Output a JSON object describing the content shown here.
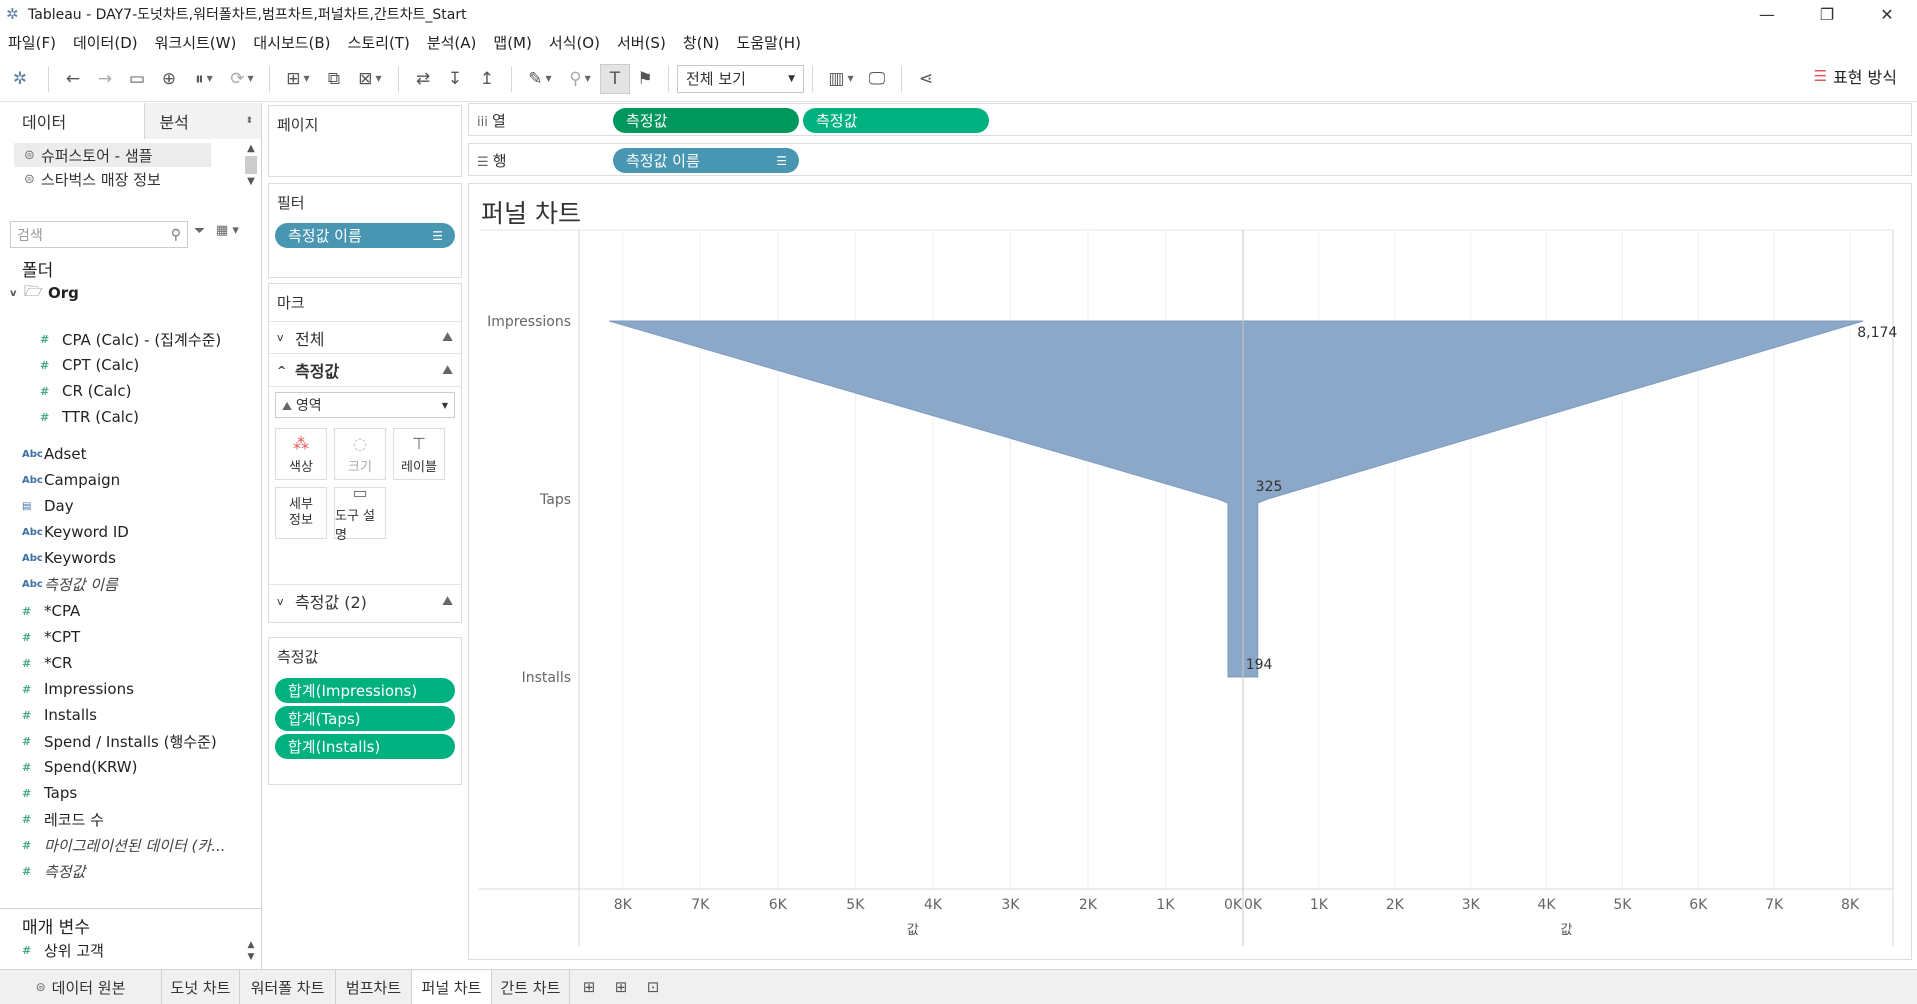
{
  "window": {
    "title": "Tableau - DAY7-도넛차트,워터폴차트,범프차트,퍼널차트,간트차트_Start",
    "minimize": "—",
    "restore": "❐",
    "close": "✕"
  },
  "menu": [
    "파일(F)",
    "데이터(D)",
    "워크시트(W)",
    "대시보드(B)",
    "스토리(T)",
    "분석(A)",
    "맵(M)",
    "서식(O)",
    "서버(S)",
    "창(N)",
    "도움말(H)"
  ],
  "toolbar": {
    "view_select": "전체 보기",
    "show_me": "표현 방식"
  },
  "data_pane": {
    "tab_data": "데이터",
    "tab_analysis": "분석",
    "datasources": [
      "슈퍼스토어 - 샘플",
      "스타벅스 매장 정보"
    ],
    "search_placeholder": "검색",
    "folders_header": "폴더",
    "folder_name": "Org",
    "calc_fields": [
      "CPA (Calc) - (집계수준)",
      "CPT (Calc)",
      "CR (Calc)",
      "TTR (Calc)"
    ],
    "dimensions": [
      "Adset",
      "Campaign",
      "Day",
      "Keyword ID",
      "Keywords",
      "측정값 이름"
    ],
    "measures": [
      "*CPA",
      "*CPT",
      "*CR",
      "Impressions",
      "Installs",
      "Spend / Installs (행수준)",
      "Spend(KRW)",
      "Taps",
      "레코드 수",
      "마이그레이션된 데이터 (카...",
      "측정값"
    ],
    "params_header": "매개 변수",
    "params": [
      "상위 고객"
    ]
  },
  "shelves": {
    "pages_label": "페이지",
    "filters_label": "필터",
    "filter_pill": "측정값 이름",
    "marks_label": "마크",
    "marks_all": "전체",
    "marks_measure": "측정값",
    "mark_type": "영역",
    "mark_buttons": [
      "색상",
      "크기",
      "레이블",
      "세부\n정보",
      "도구 설명"
    ],
    "marks_measure2": "측정값 (2)",
    "measure_values_label": "측정값",
    "measure_values": [
      "합계(Impressions)",
      "합계(Taps)",
      "합계(Installs)"
    ],
    "columns_label": "열",
    "columns_pills": [
      "측정값",
      "측정값"
    ],
    "rows_label": "행",
    "rows_pill": "측정값 이름"
  },
  "viz": {
    "title": "퍼널 차트"
  },
  "chart_data": {
    "type": "area",
    "categories": [
      "Impressions",
      "Taps",
      "Installs"
    ],
    "values": [
      8174,
      325,
      194
    ],
    "value_labels": [
      "8,174",
      "325",
      "194"
    ],
    "x_ticks_left": [
      "8K",
      "7K",
      "6K",
      "5K",
      "4K",
      "3K",
      "2K",
      "1K",
      "0K"
    ],
    "x_ticks_right": [
      "0K",
      "1K",
      "2K",
      "3K",
      "4K",
      "5K",
      "6K",
      "7K",
      "8K"
    ],
    "xlabel_left": "값",
    "xlabel_right": "값",
    "xlim": [
      0,
      8500
    ],
    "color": "#8ba8c9",
    "grid": true
  },
  "bottom_tabs": [
    "데이터 원본",
    "도넛 차트",
    "워터폴 차트",
    "범프차트",
    "퍼널 차트",
    "간트 차트"
  ]
}
